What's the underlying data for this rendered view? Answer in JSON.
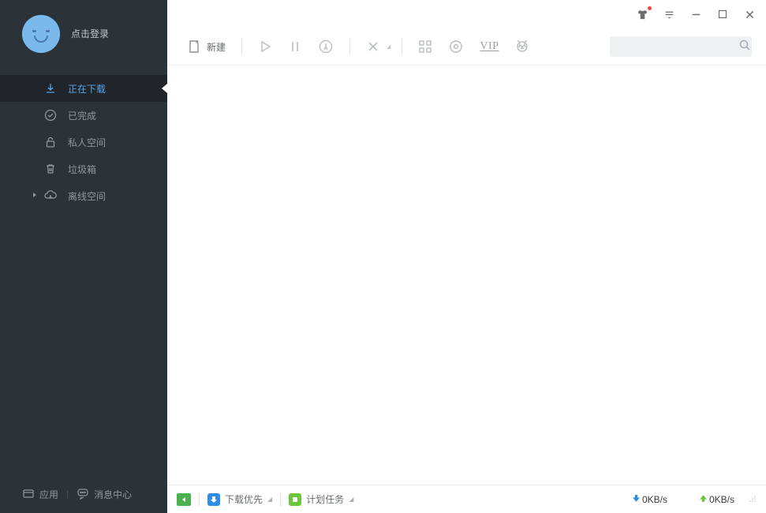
{
  "sidebar": {
    "login_label": "点击登录",
    "nav": [
      {
        "label": "正在下载",
        "icon": "download"
      },
      {
        "label": "已完成",
        "icon": "check"
      },
      {
        "label": "私人空间",
        "icon": "lock"
      },
      {
        "label": "垃圾箱",
        "icon": "trash"
      },
      {
        "label": "离线空间",
        "icon": "cloud"
      }
    ],
    "footer": {
      "apps": "应用",
      "messages": "消息中心"
    }
  },
  "toolbar": {
    "new_label": "新建",
    "vip_label": "VIP"
  },
  "search": {
    "placeholder": ""
  },
  "statusbar": {
    "priority_label": "下载优先",
    "schedule_label": "计划任务",
    "down_speed": "0KB/s",
    "up_speed": "0KB/s"
  }
}
